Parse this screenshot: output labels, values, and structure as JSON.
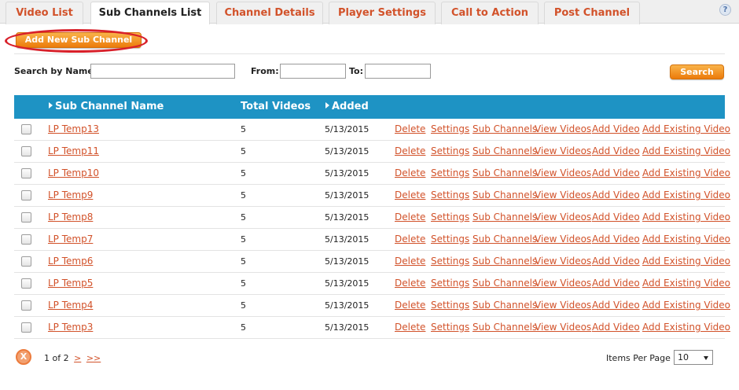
{
  "tabs": [
    {
      "label": "Video List",
      "active": false
    },
    {
      "label": "Sub Channels List",
      "active": true
    },
    {
      "label": "Channel Details",
      "active": false
    },
    {
      "label": "Player Settings",
      "active": false
    },
    {
      "label": "Call to Action",
      "active": false
    },
    {
      "label": "Post Channel",
      "active": false
    }
  ],
  "help_icon": "?",
  "toolbar": {
    "add_label": "Add New Sub Channel"
  },
  "search": {
    "name_label": "Search by Name:",
    "name_value": "",
    "from_label": "From:",
    "from_value": "",
    "to_label": "To:",
    "to_value": "",
    "button_label": "Search"
  },
  "table": {
    "headers": {
      "name": "Sub Channel Name",
      "total": "Total Videos",
      "added": "Added"
    },
    "header_color": "#1e93c4",
    "action_labels": {
      "delete": "Delete",
      "settings": "Settings",
      "sub_channels": "Sub Channels",
      "view_videos": "View Videos",
      "add_video": "Add Video",
      "add_existing": "Add Existing Video"
    },
    "rows": [
      {
        "name": "LP Temp13",
        "total": "5",
        "added": "5/13/2015"
      },
      {
        "name": "LP Temp11",
        "total": "5",
        "added": "5/13/2015"
      },
      {
        "name": "LP Temp10",
        "total": "5",
        "added": "5/13/2015"
      },
      {
        "name": "LP Temp9",
        "total": "5",
        "added": "5/13/2015"
      },
      {
        "name": "LP Temp8",
        "total": "5",
        "added": "5/13/2015"
      },
      {
        "name": "LP Temp7",
        "total": "5",
        "added": "5/13/2015"
      },
      {
        "name": "LP Temp6",
        "total": "5",
        "added": "5/13/2015"
      },
      {
        "name": "LP Temp5",
        "total": "5",
        "added": "5/13/2015"
      },
      {
        "name": "LP Temp4",
        "total": "5",
        "added": "5/13/2015"
      },
      {
        "name": "LP Temp3",
        "total": "5",
        "added": "5/13/2015"
      }
    ]
  },
  "pager": {
    "close_glyph": "X",
    "text": "1 of 2",
    "next": ">",
    "last": ">>",
    "items_per_page_label": "Items Per Page",
    "items_per_page_value": "10"
  },
  "colors": {
    "accent": "#d2522a",
    "button": "#ec7b0a",
    "highlight": "#d8202a"
  }
}
